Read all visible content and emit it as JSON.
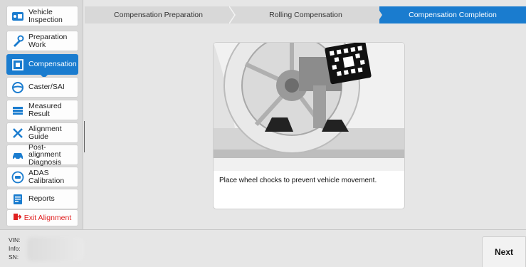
{
  "sidebar": {
    "items": [
      {
        "label": "Vehicle Inspection",
        "icon": "vehicle-inspection-icon"
      },
      {
        "label": "Preparation Work",
        "icon": "wrench-icon"
      },
      {
        "label": "Compensation",
        "icon": "compensation-icon",
        "active": true
      },
      {
        "label": "Caster/SAI",
        "icon": "steering-wheel-icon"
      },
      {
        "label": "Measured Result",
        "icon": "list-icon"
      },
      {
        "label": "Alignment Guide",
        "icon": "tools-icon"
      },
      {
        "label": "Post-alignment Diagnosis",
        "icon": "car-icon"
      },
      {
        "label": "ADAS Calibration",
        "icon": "adas-icon"
      },
      {
        "label": "Reports",
        "icon": "report-icon"
      }
    ],
    "exit_label": "Exit Alignment"
  },
  "steps": [
    {
      "label": "Compensation Preparation"
    },
    {
      "label": "Rolling Compensation"
    },
    {
      "label": "Compensation Completion",
      "active": true
    }
  ],
  "main": {
    "caption": "Place wheel chocks to prevent vehicle movement."
  },
  "footer": {
    "vin_label": "VIN:",
    "info_label": "Info:",
    "sn_label": "SN:",
    "next_label": "Next"
  },
  "colors": {
    "accent": "#1a7ccf",
    "exit": "#e02020"
  }
}
